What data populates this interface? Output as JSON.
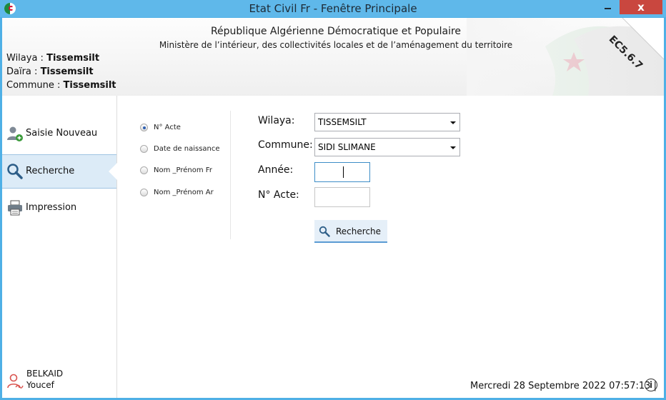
{
  "window": {
    "title": "Etat Civil Fr - Fenêtre Principale",
    "close_label": "x"
  },
  "header": {
    "republic": "République Algérienne Démocratique et Populaire",
    "ministry": "Ministère de l’intérieur, des collectivités locales et de l’aménagement du territoire",
    "wilaya_label": "Wilaya :",
    "wilaya_value": "Tissemsilt",
    "daira_label": "Daïra :",
    "daira_value": "Tissemsilt",
    "commune_label": "Commune :",
    "commune_value": "Tissemsilt",
    "version": "EC5.6.7"
  },
  "sidebar": {
    "items": [
      {
        "label": "Saisie Nouveau",
        "icon": "add-user-icon",
        "active": false
      },
      {
        "label": "Recherche",
        "icon": "search-icon",
        "active": true
      },
      {
        "label": "Impression",
        "icon": "printer-icon",
        "active": false
      }
    ],
    "user": {
      "name_line1": "BELKAID",
      "name_line2": "Youcef",
      "icon": "user-signature-icon"
    }
  },
  "search_options": [
    {
      "label": "N° Acte",
      "checked": true
    },
    {
      "label": "Date de naissance",
      "checked": false
    },
    {
      "label": "Nom _Prénom Fr",
      "checked": false
    },
    {
      "label": "Nom _Prénom Ar",
      "checked": false
    }
  ],
  "form": {
    "wilaya_label": "Wilaya:",
    "wilaya_value": "TISSEMSILT",
    "commune_label": "Commune:",
    "commune_value": "SIDI SLIMANE",
    "annee_label": "Année:",
    "annee_value": "",
    "nacte_label": "N° Acte:",
    "nacte_value": "",
    "search_button": "Recherche"
  },
  "footer": {
    "datetime": "Mercredi 28 Septembre 2022   07:57:13 |"
  },
  "colors": {
    "titlebar": "#5fb8ea",
    "close": "#c9473f",
    "active_nav": "#dcebf7",
    "flag_green": "#1d8a3f",
    "flag_red": "#d21034"
  }
}
